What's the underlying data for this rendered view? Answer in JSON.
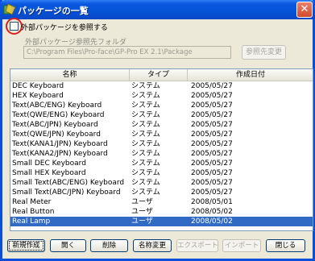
{
  "window": {
    "title": "パッケージの一覧",
    "close_glyph": "✕"
  },
  "external": {
    "checkbox_label": "外部パッケージを参照する",
    "folder_label": "外部パッケージ参照先フォルダ",
    "folder_value": "C:\\Program Files\\Pro-face\\GP-Pro EX 2.1\\Package",
    "browse_label": "参照先変更"
  },
  "table": {
    "headers": [
      "名称",
      "タイプ",
      "作成日付"
    ],
    "rows": [
      {
        "name": "DEC Keyboard",
        "type": "システム",
        "date": "2005/05/27"
      },
      {
        "name": "HEX Keyboard",
        "type": "システム",
        "date": "2005/05/27"
      },
      {
        "name": "Text(ABC/ENG) Keyboard",
        "type": "システム",
        "date": "2005/05/27"
      },
      {
        "name": "Text(QWE/ENG) Keyboard",
        "type": "システム",
        "date": "2005/05/27"
      },
      {
        "name": "Text(ABC/JPN) Keyboard",
        "type": "システム",
        "date": "2005/05/27"
      },
      {
        "name": "Text(QWE/JPN) Keyboard",
        "type": "システム",
        "date": "2005/05/27"
      },
      {
        "name": "Text(KANA1/JPN) Keyboard",
        "type": "システム",
        "date": "2005/05/27"
      },
      {
        "name": "Text(KANA2/JPN) Keyboard",
        "type": "システム",
        "date": "2005/05/27"
      },
      {
        "name": "Small DEC Keyboard",
        "type": "システム",
        "date": "2005/05/27"
      },
      {
        "name": "Small HEX Keyboard",
        "type": "システム",
        "date": "2005/05/27"
      },
      {
        "name": "Small Text(ABC/ENG) Keyboard",
        "type": "システム",
        "date": "2005/05/27"
      },
      {
        "name": "Small Text(ABC/JPN) Keyboard",
        "type": "システム",
        "date": "2005/05/27"
      },
      {
        "name": "Real Meter",
        "type": "ユーザ",
        "date": "2008/05/01"
      },
      {
        "name": "Real Button",
        "type": "ユーザ",
        "date": "2008/05/02"
      },
      {
        "name": "Real Lamp",
        "type": "ユーザ",
        "date": "2008/05/02",
        "selected": true
      }
    ]
  },
  "buttons": {
    "new": "新規作成",
    "open": "開く",
    "delete": "削除",
    "rename": "名称変更",
    "export": "エクスポート",
    "import": "インポート",
    "close": "閉じる"
  },
  "colors": {
    "title_bar": "#0553d6",
    "selection": "#316ac5",
    "highlight_ring": "#d82020"
  }
}
